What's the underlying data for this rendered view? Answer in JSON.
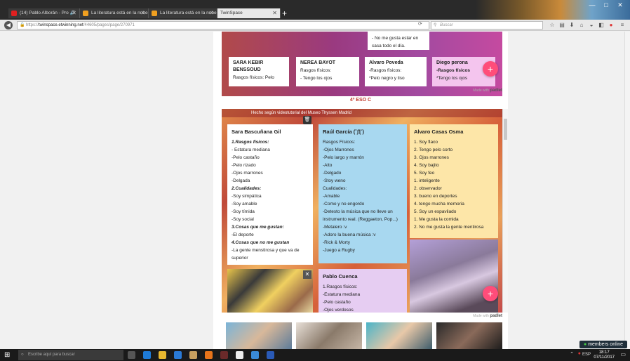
{
  "browser": {
    "tabs": [
      {
        "title": "(14) Pablo Alborán - Pro",
        "favicon_color": "#e02020"
      },
      {
        "title": "La literatura está en la nube",
        "favicon_color": "#f0a020"
      },
      {
        "title": "La literatura está en la nube",
        "favicon_color": "#f0a020"
      },
      {
        "title": "TwinSpace",
        "favicon_color": "#6a6a6a"
      }
    ],
    "new_tab_label": "+",
    "url_prefix": "https://",
    "url_host": "twinspace.etwinning.net",
    "url_path": "/44605/pages/page/270971",
    "search_placeholder": "Buscar",
    "window_controls": [
      "—",
      "□",
      "✕"
    ]
  },
  "padlet_top": {
    "cards": [
      {
        "name": "SARA KEBIR BENSSOUD",
        "lines": [
          "Rasgos físicos: Pelo"
        ]
      },
      {
        "name": "NEREA BAYOT",
        "lines": [
          "Rasgos físicos:",
          "- Tengo los ojos"
        ]
      },
      {
        "name": "Alvaro Poveda",
        "lines": [
          "-Rasgos físicos:",
          "*Pelo negro y liso"
        ]
      },
      {
        "name": "Diego perona",
        "lines": [
          "-Rasgos físicos",
          "*Tengo los ojos"
        ]
      }
    ],
    "overflow_card_lines": [
      "- No me gusta estar en",
      "casa todo el día."
    ],
    "made_with_prefix": "Made with",
    "made_with_brand": "padlet",
    "add_button": "+"
  },
  "section_title": "4º ESO C",
  "padlet_main": {
    "header": "Hecho según videotutorial del Museo Thyssen Madrid",
    "trash_icon": "🗑",
    "columns": {
      "sara": {
        "name": "Sara Bascuñana Gil",
        "lines": [
          {
            "t": "1.Rasgos físicos:",
            "b": true
          },
          {
            "t": "- Estatura mediana"
          },
          {
            "t": "-Pelo castaño"
          },
          {
            "t": "-Pelo rizado"
          },
          {
            "t": "-Ojos marrones"
          },
          {
            "t": "-Delgada"
          },
          {
            "t": "2.Cualidades:",
            "b": true
          },
          {
            "t": "-Soy simpática"
          },
          {
            "t": "-Soy amable"
          },
          {
            "t": "-Soy tímida"
          },
          {
            "t": "-Soy social"
          },
          {
            "t": "3.Cosas que me gustan:",
            "b": true
          },
          {
            "t": "-El deporte"
          },
          {
            "t": "4.Cosas que no me gustan",
            "b": true
          },
          {
            "t": "-La gente menstirosa y que va de"
          },
          {
            "t": "superior"
          }
        ]
      },
      "raul": {
        "name": "Raúl García (˘ʃƪ˘)",
        "lines": [
          "Rasgos Físicos:",
          "-Ojos Marrones",
          "-Pelo largo y marrón",
          "-Alto",
          "-Delgado",
          "-Stoy weno",
          "Cualidades:",
          "-Amable",
          "-Como y no engordo",
          "-Detesto la música que no lleve un",
          "instrumento real. (Reggaeton, Pop...)",
          "-Metalero :v",
          "-Adoro la buena música :v",
          "-Rick & Morty",
          "-Juego a Rugby"
        ]
      },
      "alvaro": {
        "name": "Alvaro Casas Osma",
        "lines": [
          "1. Soy flaco",
          "2. Tengo pelo corto",
          "3.  Ojos marrones",
          "4. Soy bajito",
          "5. Soy feo",
          "1. inteligente",
          "2. observador",
          "3. bueno en deportes",
          "4. tengo mucha memoria",
          "5.  Soy un espavilado",
          "1. Me gusta la comida",
          "2. No me gusta la gente mentirosa"
        ]
      },
      "pablo": {
        "name": "Pablo Cuenca",
        "lines": [
          "1.Rasgos físicos:",
          "-Estatura mediana",
          "-Pelo castaño",
          "-Ojos verdosos"
        ]
      }
    },
    "image_close": "✕",
    "add_button": "+",
    "made_with_prefix": "Made with",
    "made_with_brand": "padlet"
  },
  "taskbar": {
    "search_placeholder": "Escribe aquí para buscar",
    "language": "ESP",
    "time": "18:17",
    "date": "07/11/2017",
    "apps": [
      {
        "name": "task-view",
        "color": "#555"
      },
      {
        "name": "edge",
        "color": "#1e7ad6"
      },
      {
        "name": "explorer",
        "color": "#e8b830"
      },
      {
        "name": "store",
        "color": "#2a7ad6"
      },
      {
        "name": "briefcase",
        "color": "#c8a060"
      },
      {
        "name": "firefox",
        "color": "#e8741a"
      },
      {
        "name": "app-dark",
        "color": "#6a2a2a"
      },
      {
        "name": "app-white",
        "color": "#eeeeee"
      },
      {
        "name": "app-blue",
        "color": "#3a8ad6"
      },
      {
        "name": "app-blue2",
        "color": "#2a5ab6"
      }
    ]
  },
  "members_badge": "members online"
}
